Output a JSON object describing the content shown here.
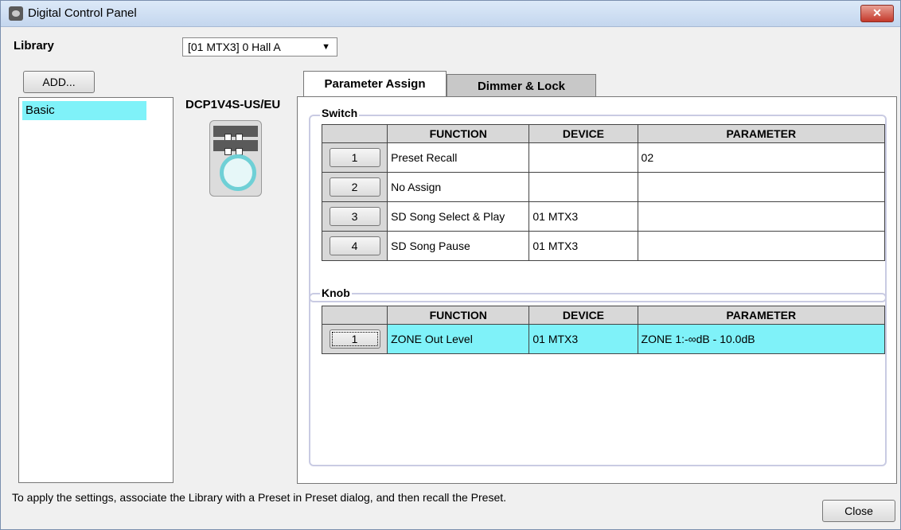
{
  "window": {
    "title": "Digital Control Panel",
    "close_glyph": "✕"
  },
  "library": {
    "label": "Library",
    "selected": "[01 MTX3] 0 Hall A",
    "dropdown_arrow": "▼"
  },
  "add_button": "ADD...",
  "library_list": {
    "items": [
      "Basic"
    ]
  },
  "model": {
    "label": "DCP1V4S-US/EU",
    "device_icon": "dcp-device-icon"
  },
  "tabs": [
    {
      "label": "Parameter Assign",
      "active": true
    },
    {
      "label": "Dimmer & Lock",
      "active": false
    }
  ],
  "switch_group": {
    "title": "Switch",
    "columns": [
      "FUNCTION",
      "DEVICE",
      "PARAMETER"
    ],
    "rows": [
      {
        "num": "1",
        "function": "Preset Recall",
        "device": "",
        "parameter": "02"
      },
      {
        "num": "2",
        "function": "No Assign",
        "device": "",
        "parameter": ""
      },
      {
        "num": "3",
        "function": "SD Song Select & Play",
        "device": "01 MTX3",
        "parameter": ""
      },
      {
        "num": "4",
        "function": "SD Song Pause",
        "device": "01 MTX3",
        "parameter": ""
      }
    ]
  },
  "knob_group": {
    "title": "Knob",
    "columns": [
      "FUNCTION",
      "DEVICE",
      "PARAMETER"
    ],
    "rows": [
      {
        "num": "1",
        "function": "ZONE Out Level",
        "device": "01 MTX3",
        "parameter": "ZONE 1:-∞dB - 10.0dB"
      }
    ]
  },
  "footer": {
    "note": "To apply the settings, associate the Library with a Preset in Preset dialog, and then recall the Preset.",
    "close_button": "Close"
  },
  "colors": {
    "selection": "#7ff2f9",
    "header_gray": "#d8d8d8",
    "group_border": "#c9cbe3"
  }
}
